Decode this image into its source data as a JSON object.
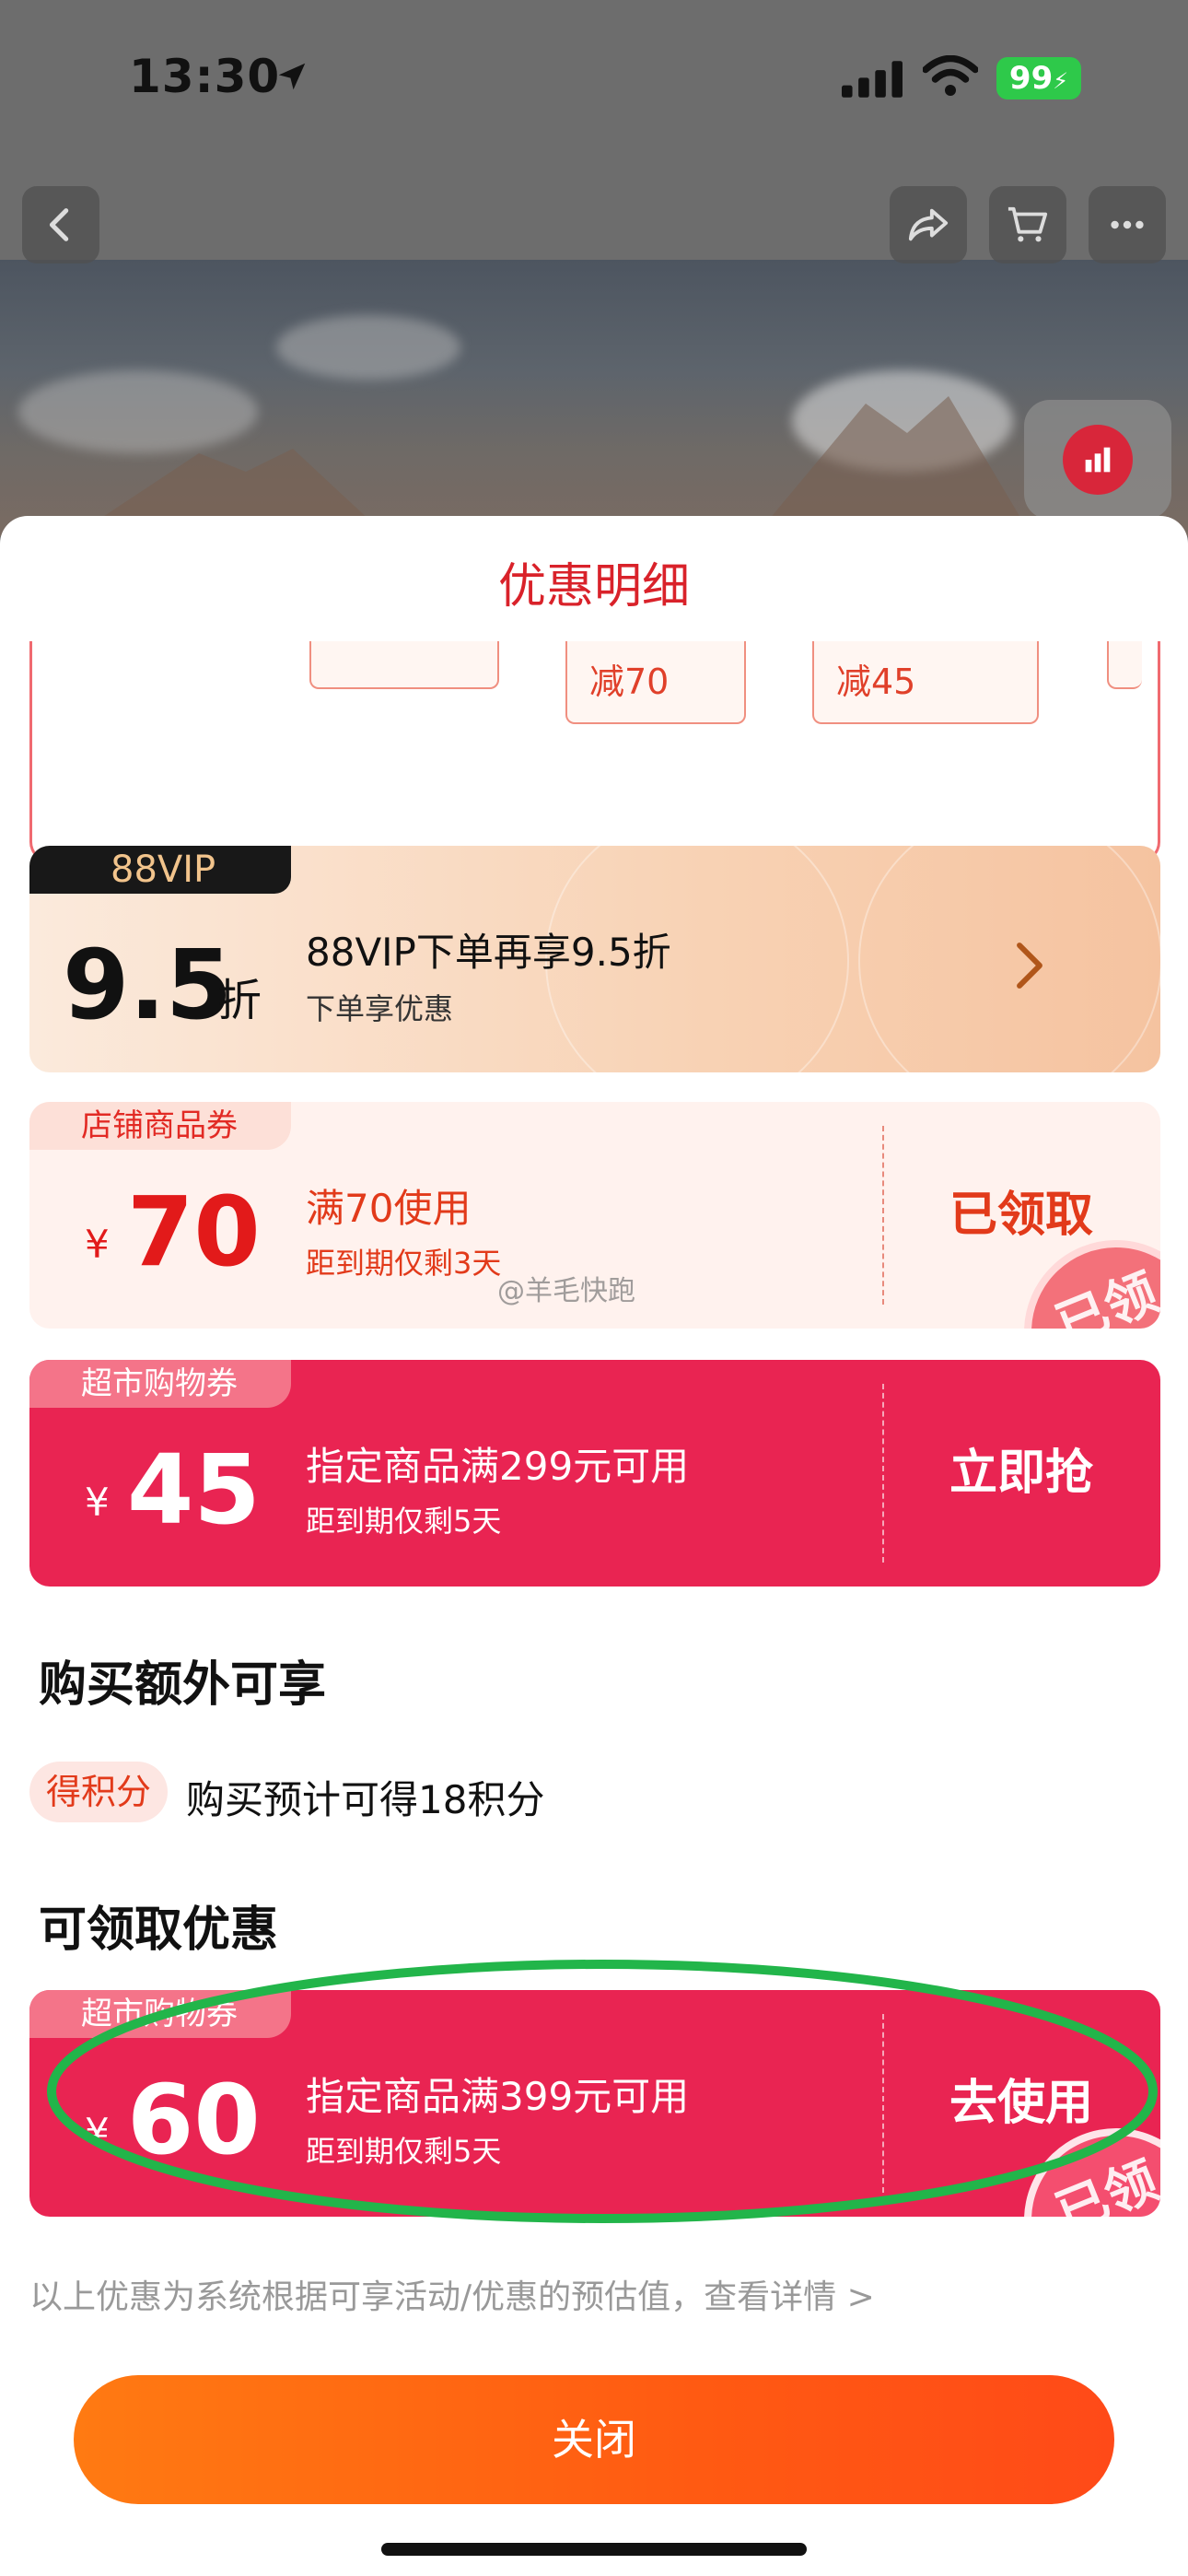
{
  "status_bar": {
    "time": "13:30",
    "battery": "99"
  },
  "sheet": {
    "title": "优惠明细",
    "promo_chips": [
      "",
      "减70",
      "减45",
      ""
    ],
    "vip": {
      "badge": "88VIP",
      "value": "9.5",
      "unit": "折",
      "line1": "88VIP下单再享9.5折",
      "line2": "下单享优惠"
    },
    "store_coupon": {
      "tag": "店铺商品券",
      "yen": "¥",
      "amount": "70",
      "line1": "满70使用",
      "line2": "距到期仅剩3天",
      "action": "已领取",
      "stamp": "已领"
    },
    "market_coupon_1": {
      "tag": "超市购物券",
      "yen": "¥",
      "amount": "45",
      "line1": "指定商品满299元可用",
      "line2": "距到期仅剩5天",
      "action": "立即抢"
    },
    "extra_title": "购买额外可享",
    "points_tag": "得积分",
    "points_text": "购买预计可得18积分",
    "available_title": "可领取优惠",
    "market_coupon_2": {
      "tag": "超市购物券",
      "yen": "¥",
      "amount": "60",
      "line1": "指定商品满399元可用",
      "line2": "距到期仅剩5天",
      "action": "去使用",
      "stamp": "已领"
    },
    "footnote": "以上优惠为系统根据可享活动/优惠的预估值，查看详情 >",
    "close_label": "关闭"
  },
  "watermark": "@羊毛快跑",
  "colors": {
    "accent_red": "#e92452",
    "orange": "#ff6a12",
    "annotation_green": "#22b54a"
  }
}
